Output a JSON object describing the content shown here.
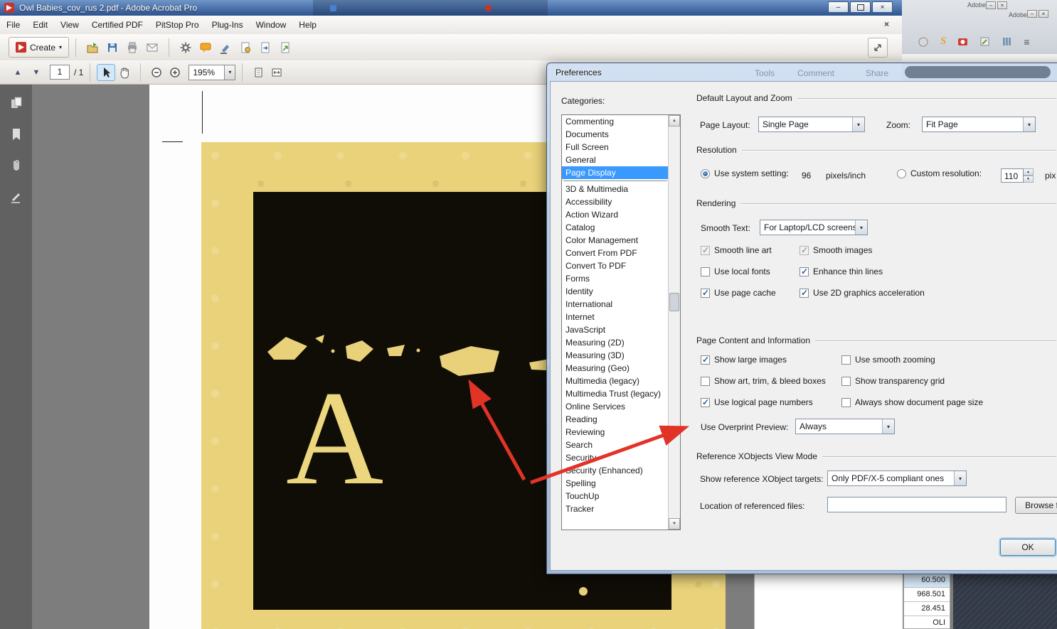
{
  "glyphs": {
    "close": "×",
    "minimize": "–",
    "dropdown": "▾",
    "up": "▲",
    "down": "▼",
    "plus": "+",
    "minus": "−",
    "hamburger": "≡"
  },
  "title_bar": {
    "title": "Owl Babies_cov_rus 2.pdf - Adobe Acrobat Pro"
  },
  "menu_bar": {
    "items": [
      "File",
      "Edit",
      "View",
      "Certified PDF",
      "PitStop Pro",
      "Plug-Ins",
      "Window",
      "Help"
    ]
  },
  "toolbar": {
    "create_label": "Create",
    "icons": [
      "open-file-icon",
      "save-icon",
      "print-icon",
      "email-icon",
      "settings-gear-icon",
      "comment-bubble-icon",
      "sign-pen-icon",
      "certify-doc-icon",
      "export-doc-icon",
      "send-doc-icon",
      "expand-toolbar-icon"
    ]
  },
  "nav_bar": {
    "page_value": "1",
    "page_total": "/ 1",
    "zoom_value": "195%",
    "icons": [
      "previous-page-icon",
      "next-page-icon",
      "select-tool-icon",
      "hand-tool-icon",
      "zoom-out-icon",
      "zoom-in-icon",
      "single-page-view-icon",
      "fit-width-view-icon"
    ]
  },
  "sidebar_icons": [
    "page-thumbnails-icon",
    "bookmarks-icon",
    "attachments-icon",
    "signatures-icon"
  ],
  "background_windows": {
    "titles": [
      "Adobe",
      "Adobe"
    ],
    "ghost_tabs": [
      "Tools",
      "Comment",
      "Share"
    ],
    "icons": [
      "sphere-icon",
      "signature-s-icon",
      "camera-icon",
      "edit-icon",
      "columns-icon",
      "menu-icon"
    ]
  },
  "document": {
    "letter": "A"
  },
  "side_panel": {
    "values": [
      "60.500",
      "968.501",
      "28.451",
      "OLI"
    ]
  },
  "colors": {
    "selection_blue": "#3a99fd",
    "arrow_red": "#e23327",
    "page_yellow": "#e9d27a",
    "letter_gold": "#ecd77e"
  },
  "preferences": {
    "title": "Preferences",
    "categories_label": "Categories:",
    "selected_category": "Page Display",
    "categories_top": [
      "Commenting",
      "Documents",
      "Full Screen",
      "General",
      "Page Display"
    ],
    "categories_bottom": [
      "3D & Multimedia",
      "Accessibility",
      "Action Wizard",
      "Catalog",
      "Color Management",
      "Convert From PDF",
      "Convert To PDF",
      "Forms",
      "Identity",
      "International",
      "Internet",
      "JavaScript",
      "Measuring (2D)",
      "Measuring (3D)",
      "Measuring (Geo)",
      "Multimedia (legacy)",
      "Multimedia Trust (legacy)",
      "Online Services",
      "Reading",
      "Reviewing",
      "Search",
      "Security",
      "Security (Enhanced)",
      "Spelling",
      "TouchUp",
      "Tracker"
    ],
    "layout_group": {
      "title": "Default Layout and Zoom",
      "page_layout_label": "Page Layout:",
      "page_layout_value": "Single Page",
      "zoom_label": "Zoom:",
      "zoom_value": "Fit Page"
    },
    "resolution_group": {
      "title": "Resolution",
      "system_label": "Use system setting:",
      "system_checked": true,
      "system_value": "96",
      "system_unit": "pixels/inch",
      "custom_label": "Custom resolution:",
      "custom_checked": false,
      "custom_value": "110",
      "custom_unit": "pix"
    },
    "rendering_group": {
      "title": "Rendering",
      "smooth_text_label": "Smooth Text:",
      "smooth_text_value": "For Laptop/LCD screens",
      "checks": [
        {
          "label": "Smooth line art",
          "checked": true,
          "disabled": true
        },
        {
          "label": "Smooth images",
          "checked": true,
          "disabled": true
        },
        {
          "label": "Use local fonts",
          "checked": false,
          "disabled": false
        },
        {
          "label": "Enhance thin lines",
          "checked": true,
          "disabled": false
        },
        {
          "label": "Use page cache",
          "checked": true,
          "disabled": false
        },
        {
          "label": "Use 2D graphics acceleration",
          "checked": true,
          "disabled": false
        }
      ]
    },
    "content_group": {
      "title": "Page Content and Information",
      "checks": [
        {
          "label": "Show large images",
          "checked": true
        },
        {
          "label": "Use smooth zooming",
          "checked": false
        },
        {
          "label": "Show art, trim, & bleed boxes",
          "checked": false
        },
        {
          "label": "Show transparency grid",
          "checked": false
        },
        {
          "label": "Use logical page numbers",
          "checked": true
        },
        {
          "label": "Always show document page size",
          "checked": false
        }
      ],
      "overprint_label": "Use Overprint Preview:",
      "overprint_value": "Always"
    },
    "xobjects_group": {
      "title": "Reference XObjects View Mode",
      "targets_label": "Show reference XObject targets:",
      "targets_value": "Only PDF/X-5 compliant ones",
      "location_label": "Location of referenced files:",
      "location_value": "",
      "browse_label": "Browse f"
    },
    "ok_label": "OK"
  }
}
